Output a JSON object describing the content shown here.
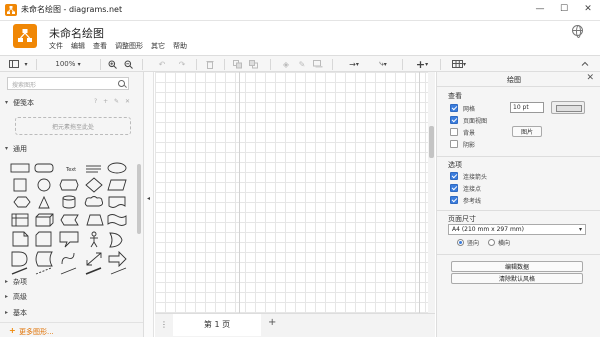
{
  "window": {
    "title": "未命名绘图 - diagrams.net",
    "controls": [
      "—",
      "☐",
      "✕"
    ]
  },
  "header": {
    "logo_text": "draw.io",
    "doc_title": "未命名绘图",
    "menu": [
      "文件",
      "编辑",
      "查看",
      "调整图形",
      "其它",
      "帮助"
    ]
  },
  "toolbar": {
    "zoom": "100%"
  },
  "sidebar": {
    "search_placeholder": "搜索图形",
    "sections": [
      {
        "label": "便笺本",
        "expanded": true
      },
      {
        "label": "通用",
        "expanded": true
      },
      {
        "label": "杂项",
        "expanded": false
      },
      {
        "label": "高级",
        "expanded": false
      },
      {
        "label": "基本",
        "expanded": false
      }
    ],
    "scratchpad_tools": "? + ✎ ✕",
    "dropzone": "把元素拖至此处",
    "more_shapes": "更多图形..."
  },
  "footer": {
    "page_tab": "第 1 页",
    "add": "+",
    "page_menu": "⋮"
  },
  "panel": {
    "title": "绘图",
    "close": "✕",
    "view_group": "查看",
    "grid": {
      "label": "网格",
      "checked": true,
      "size": "10 pt"
    },
    "page_view": {
      "label": "页面视图",
      "checked": true
    },
    "background": {
      "label": "背景",
      "checked": false,
      "button": "图片"
    },
    "shadow": {
      "label": "阴影",
      "checked": false
    },
    "options_group": "选项",
    "connection_arrows": {
      "label": "连接箭头",
      "checked": true
    },
    "connection_points": {
      "label": "连接点",
      "checked": true
    },
    "guides": {
      "label": "参考线",
      "checked": true
    },
    "paper_size_group": "页面尺寸",
    "paper_size": "A4 (210 mm x 297 mm)",
    "orientation": {
      "portrait": "竖向",
      "landscape": "横向",
      "selected": "portrait"
    },
    "edit_data": "编辑数据",
    "clear_default_style": "清除默认风格"
  },
  "colors": {
    "accent": "#f08705",
    "checkbox": "#3b7ddd",
    "grid": "#e6e6e6"
  }
}
